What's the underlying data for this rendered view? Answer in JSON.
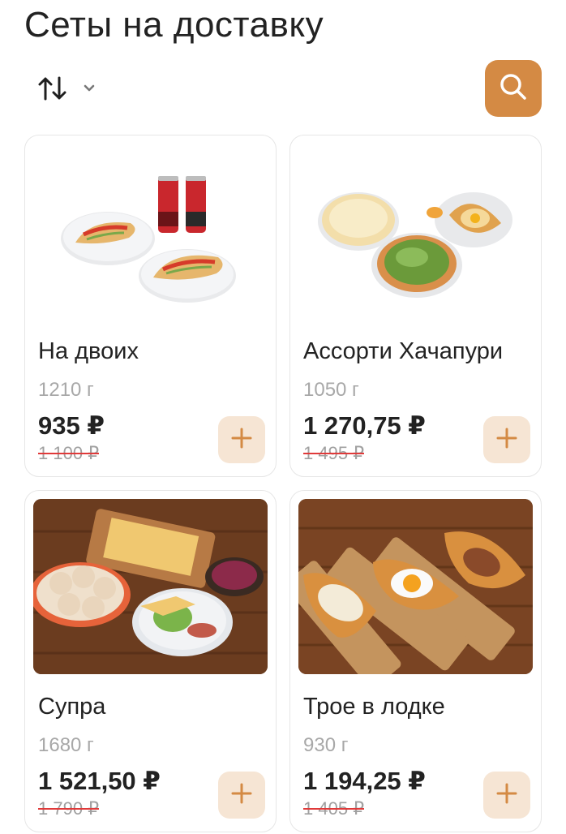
{
  "page": {
    "title": "Сеты на доставку"
  },
  "toolbar": {
    "sort_icon": "sort-arrows-icon",
    "dropdown_icon": "chevron-down-icon",
    "search_icon": "search-icon",
    "accent": "#d48a44"
  },
  "products": [
    {
      "name": "На двоих",
      "weight": "1210 г",
      "price": "935 ₽",
      "old_price": "1 100 ₽"
    },
    {
      "name": "Ассорти Хачапури",
      "weight": "1050 г",
      "price": "1 270,75 ₽",
      "old_price": "1 495 ₽"
    },
    {
      "name": "Супра",
      "weight": "1680 г",
      "price": "1 521,50 ₽",
      "old_price": "1 790 ₽"
    },
    {
      "name": "Трое в лодке",
      "weight": "930 г",
      "price": "1 194,25 ₽",
      "old_price": "1 405 ₽"
    }
  ]
}
